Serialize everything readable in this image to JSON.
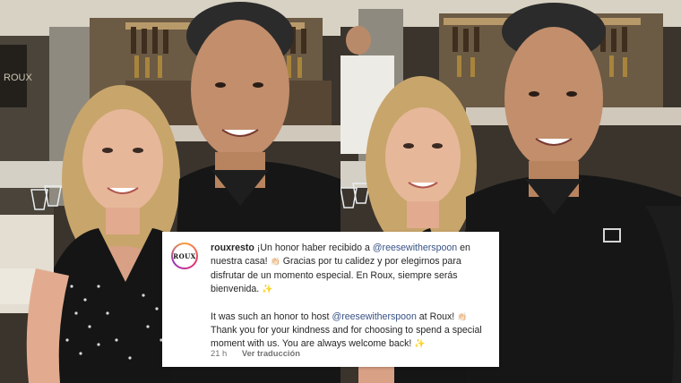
{
  "comment": {
    "username": "rouxresto",
    "avatar_text": "ROUX",
    "spanish_part1": " ¡Un honor haber recibido a ",
    "mention_1": "@reesewitherspoon",
    "spanish_part2": " en nuestra casa! ",
    "clap_1": "👏🏻",
    "spanish_part3": " Gracias por tu calidez y por elegirnos para disfrutar de un momento especial. En Roux, siempre serás bienvenida. ",
    "spark_1": "✨",
    "english_part1": "It was such an honor to host ",
    "mention_2": "@reesewitherspoon",
    "english_part2": " at Roux! ",
    "clap_2": "👏🏻",
    "english_part3": " Thank you for your kindness and for choosing to spend a special moment with us. You are always welcome back! ",
    "spark_2": "✨",
    "time": "21 h",
    "translate_label": "Ver traducción"
  },
  "photo_left": {
    "sign_text": "ROUX"
  }
}
